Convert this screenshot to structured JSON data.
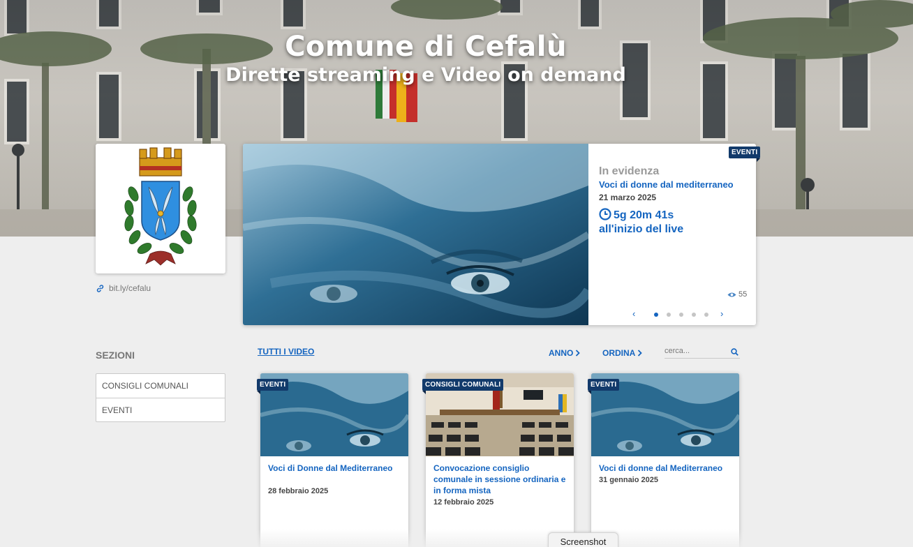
{
  "header": {
    "title": "Comune di Cefalù",
    "subtitle": "Dirette streaming e Video on demand"
  },
  "sidebar": {
    "short_link": "bit.ly/cefalu",
    "sections_title": "SEZIONI",
    "sections": [
      {
        "label": "CONSIGLI COMUNALI"
      },
      {
        "label": "EVENTI"
      }
    ]
  },
  "featured": {
    "tag": "EVENTI",
    "kicker": "In evidenza",
    "title": "Voci di donne dal mediterraneo",
    "date": "21 marzo 2025",
    "countdown": "5g 20m 41s",
    "countdown_suffix": "all'inizio del live",
    "views": "55",
    "slides_total": 5,
    "active_slide": 1
  },
  "filters": {
    "all_videos": "TUTTI I VIDEO",
    "year": "ANNO",
    "order": "ORDINA",
    "search_placeholder": "cerca..."
  },
  "videos": [
    {
      "tag": "EVENTI",
      "title": "Voci di Donne dal Mediterraneo",
      "date": "28 febbraio 2025"
    },
    {
      "tag": "CONSIGLI COMUNALI",
      "title": "Convocazione consiglio comunale in sessione ordinaria e in forma mista",
      "date": "12 febbraio 2025"
    },
    {
      "tag": "EVENTI",
      "title": "Voci di donne dal Mediterraneo",
      "date": "31 gennaio 2025"
    }
  ],
  "overlay": {
    "screenshot_label": "Screenshot"
  },
  "colors": {
    "accent": "#1565c0",
    "tag_bg": "#123a6b",
    "page_bg": "#eeeeee"
  }
}
